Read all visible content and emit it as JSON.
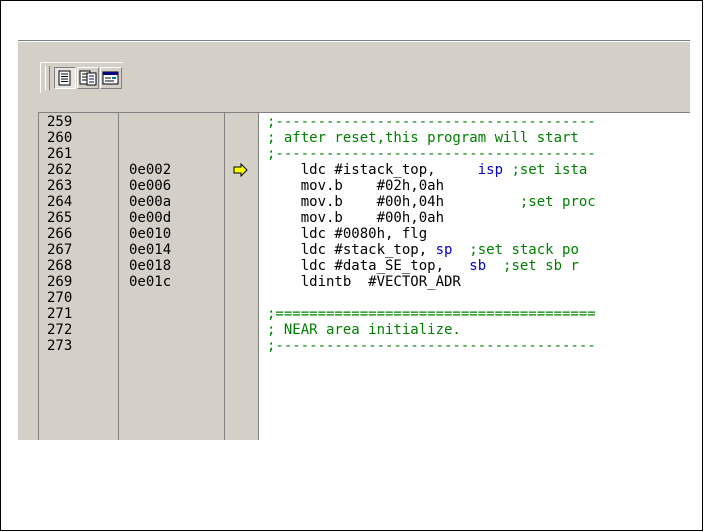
{
  "toolbar": {
    "buttons": [
      {
        "name": "source-view-icon",
        "pressed": true
      },
      {
        "name": "mixed-view-icon",
        "pressed": false
      },
      {
        "name": "disassembly-view-icon",
        "pressed": false
      }
    ]
  },
  "colors": {
    "comment": "#008000",
    "register": "#0000cc",
    "arrow": "#ffff00"
  },
  "lines": [
    {
      "num": "259",
      "addr": "",
      "current": false,
      "segments": [
        {
          "t": ";--------------------------------------",
          "c": "cmt"
        }
      ]
    },
    {
      "num": "260",
      "addr": "",
      "current": false,
      "segments": [
        {
          "t": "; after reset,this program will start",
          "c": "cmt"
        }
      ]
    },
    {
      "num": "261",
      "addr": "",
      "current": false,
      "segments": [
        {
          "t": ";--------------------------------------",
          "c": "cmt"
        }
      ]
    },
    {
      "num": "262",
      "addr": "0e002",
      "current": true,
      "segments": [
        {
          "t": "    ldc #istack_top,     ",
          "c": ""
        },
        {
          "t": "isp",
          "c": "reg"
        },
        {
          "t": " ;set ista",
          "c": "cmt"
        }
      ]
    },
    {
      "num": "263",
      "addr": "0e006",
      "current": false,
      "segments": [
        {
          "t": "    mov.b    #02h,0ah",
          "c": ""
        }
      ]
    },
    {
      "num": "264",
      "addr": "0e00a",
      "current": false,
      "segments": [
        {
          "t": "    mov.b    #00h,04h        ",
          "c": ""
        },
        {
          "t": " ;set proc",
          "c": "cmt"
        }
      ]
    },
    {
      "num": "265",
      "addr": "0e00d",
      "current": false,
      "segments": [
        {
          "t": "    mov.b    #00h,0ah",
          "c": ""
        }
      ]
    },
    {
      "num": "266",
      "addr": "0e010",
      "current": false,
      "segments": [
        {
          "t": "    ldc #0080h, flg",
          "c": ""
        }
      ]
    },
    {
      "num": "267",
      "addr": "0e014",
      "current": false,
      "segments": [
        {
          "t": "    ldc #stack_top, ",
          "c": ""
        },
        {
          "t": "sp",
          "c": "reg"
        },
        {
          "t": "  ;set stack po",
          "c": "cmt"
        }
      ]
    },
    {
      "num": "268",
      "addr": "0e018",
      "current": false,
      "segments": [
        {
          "t": "    ldc #data_SE_top,   ",
          "c": ""
        },
        {
          "t": "sb",
          "c": "reg"
        },
        {
          "t": "  ;set sb r",
          "c": "cmt"
        }
      ]
    },
    {
      "num": "269",
      "addr": "0e01c",
      "current": false,
      "segments": [
        {
          "t": "    ldintb  #VECTOR_ADR",
          "c": ""
        }
      ]
    },
    {
      "num": "270",
      "addr": "",
      "current": false,
      "segments": [
        {
          "t": "",
          "c": ""
        }
      ]
    },
    {
      "num": "271",
      "addr": "",
      "current": false,
      "segments": [
        {
          "t": ";======================================",
          "c": "cmt"
        }
      ]
    },
    {
      "num": "272",
      "addr": "",
      "current": false,
      "segments": [
        {
          "t": "; NEAR area initialize.",
          "c": "cmt"
        }
      ]
    },
    {
      "num": "273",
      "addr": "",
      "current": false,
      "segments": [
        {
          "t": ";--------------------------------------",
          "c": "cmt"
        }
      ]
    }
  ]
}
